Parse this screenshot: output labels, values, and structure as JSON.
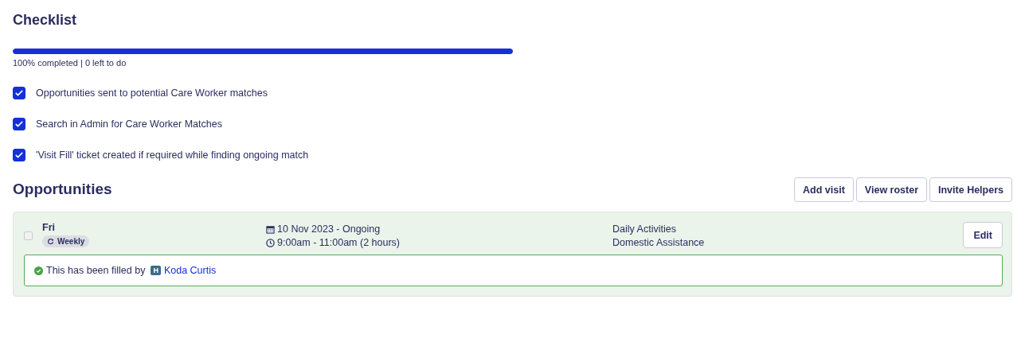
{
  "checklist": {
    "title": "Checklist",
    "progress": {
      "level": 1,
      "summary": "100% completed | 0 left to do"
    },
    "items": [
      {
        "label": "Opportunities sent to potential Care Worker matches",
        "checked": true
      },
      {
        "label": "Search in Admin for Care Worker Matches",
        "checked": true
      },
      {
        "label": "'Visit Fill' ticket created if required while finding ongoing match",
        "checked": true
      }
    ]
  },
  "opportunities": {
    "title": "Opportunities",
    "buttons": [
      "Add visit",
      "View roster",
      "Invite Helpers"
    ],
    "items": [
      {
        "selected": false,
        "filled": true,
        "day": "Fri",
        "recurrence": "Weekly",
        "date": "10 Nov 2023 - Ongoing",
        "time": "9:00am - 11:00am (2 hours)",
        "services": [
          "Daily Activities",
          "Domestic Assistance"
        ],
        "edit": "Edit",
        "filled_text": "This has been filled by",
        "helper_badge": "H",
        "helper_name": "Koda Curtis"
      }
    ]
  }
}
